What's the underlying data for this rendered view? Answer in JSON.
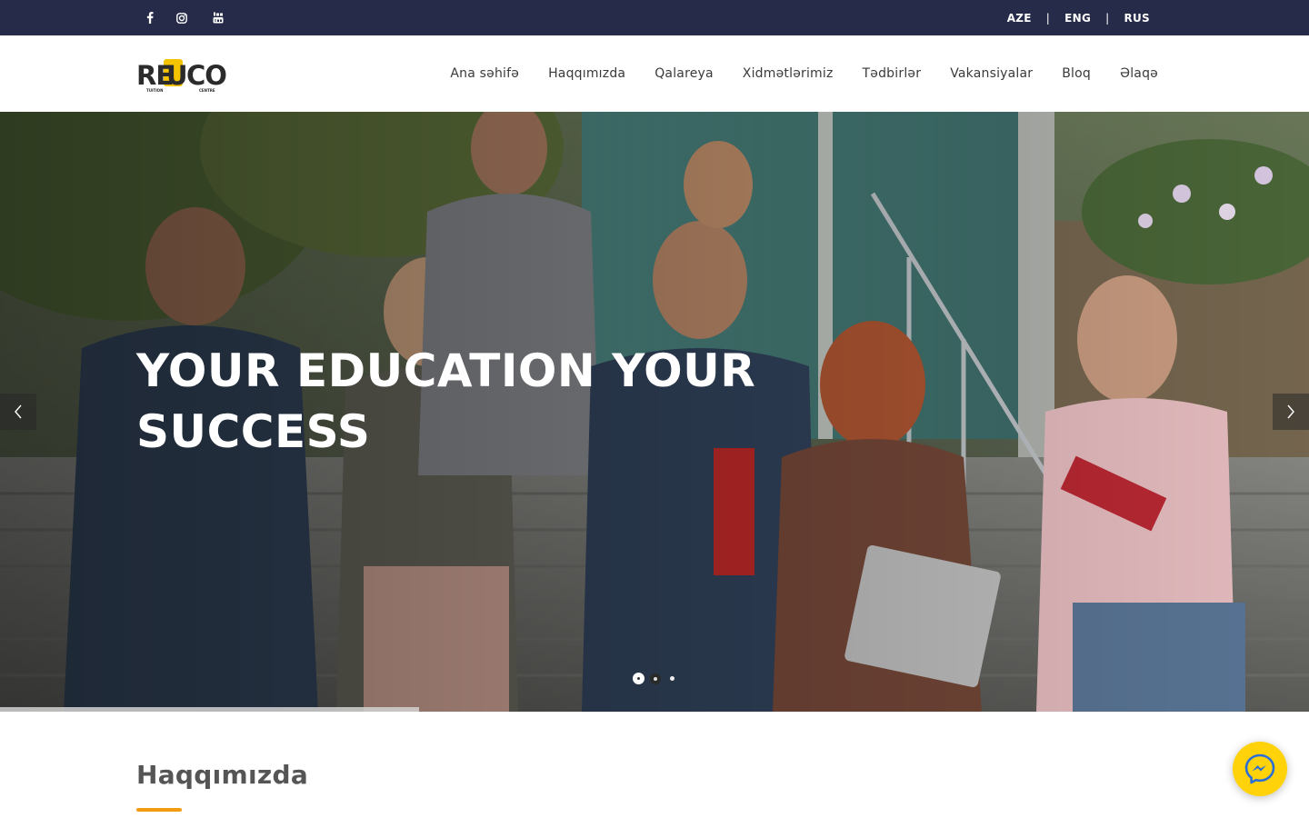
{
  "topbar": {
    "social": [
      {
        "icon": "facebook-icon"
      },
      {
        "icon": "instagram-icon"
      },
      {
        "icon": "youtube-icon"
      }
    ],
    "languages": [
      "AZE",
      "ENG",
      "RUS"
    ],
    "separator": "|"
  },
  "header": {
    "logo_text": "REDUCO",
    "logo_sub_left": "TUITION",
    "logo_sub_right": "CENTRE",
    "nav": [
      "Ana səhifə",
      "Haqqımızda",
      "Qalareya",
      "Xidmətlərimiz",
      "Tədbirlər",
      "Vakansiyalar",
      "Bloq",
      "Əlaqə"
    ]
  },
  "hero": {
    "title": "YOUR EDUCATION YOUR SUCCESS",
    "slide_count": 3,
    "active_slide": 1,
    "progress": 0.32
  },
  "about": {
    "title": "Haqqımızda"
  },
  "colors": {
    "topbar": "#252b48",
    "accent": "#f39c12",
    "logo_yellow": "#f5c400",
    "messenger": "#ffd20a"
  }
}
